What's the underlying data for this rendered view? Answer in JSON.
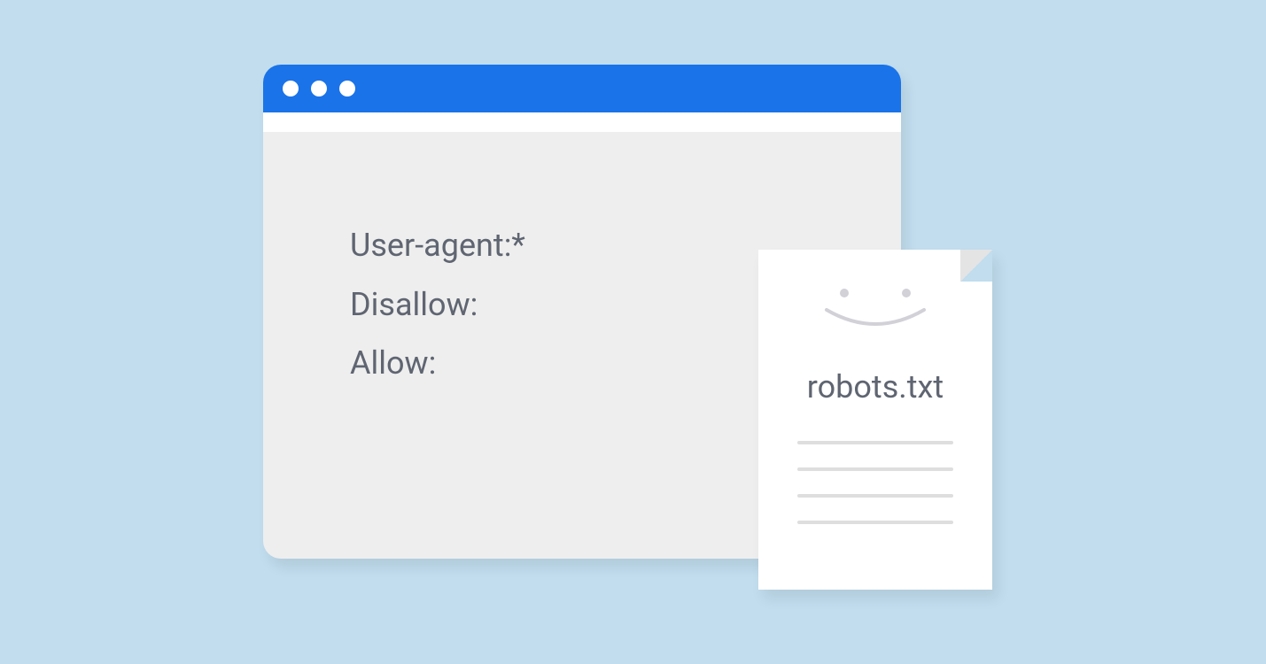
{
  "browser": {
    "lines": [
      "User-agent:*",
      "Disallow:",
      "Allow:"
    ]
  },
  "document": {
    "title": "robots.txt"
  }
}
